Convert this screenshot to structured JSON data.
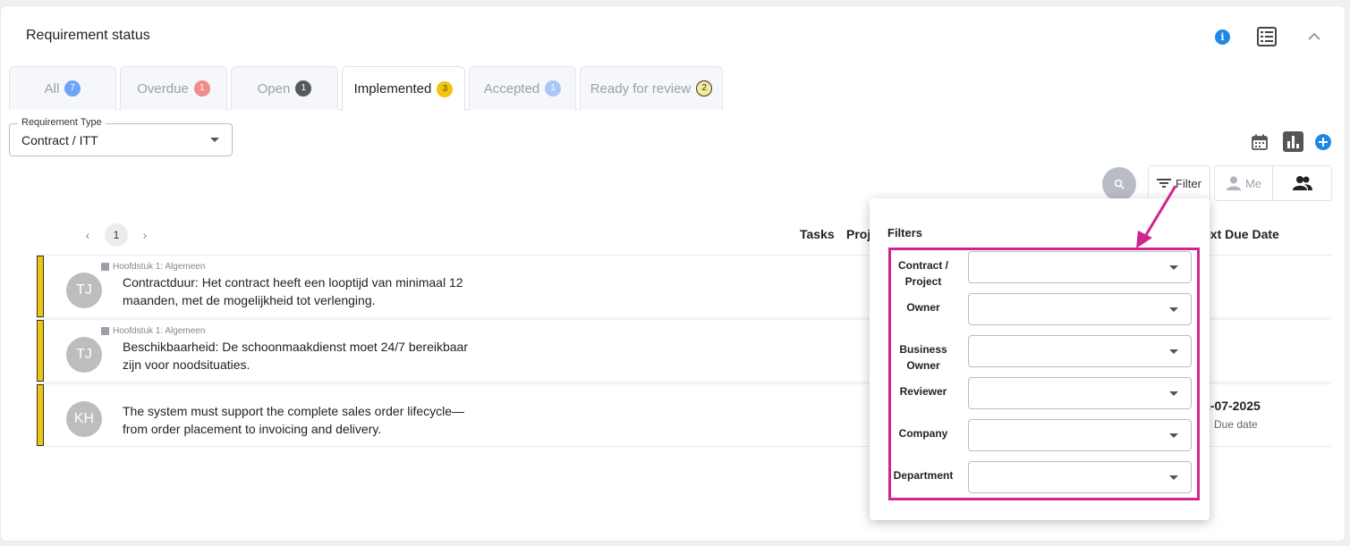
{
  "header": {
    "title": "Requirement status"
  },
  "tabs": [
    {
      "label": "All",
      "count": "7",
      "badge_color": "#6fa3f7"
    },
    {
      "label": "Overdue",
      "count": "1",
      "badge_color": "#f28b8b"
    },
    {
      "label": "Open",
      "count": "1",
      "badge_color": "#555a60"
    },
    {
      "label": "Implemented",
      "count": "3",
      "badge_color": "#f2c40f",
      "active": true
    },
    {
      "label": "Accepted",
      "count": "1",
      "badge_color": "#a9c8f7"
    },
    {
      "label": "Ready for review",
      "count": "2",
      "badge_color": "#f7e99a"
    }
  ],
  "requirement_type": {
    "label": "Requirement Type",
    "value": "Contract / ITT"
  },
  "toolbar": {
    "filter_label": "Filter",
    "me_label": "Me"
  },
  "pager": {
    "current": "1"
  },
  "columns": {
    "tasks": "Tasks",
    "project": "Proj",
    "next_due": "ext Due Date"
  },
  "rows": [
    {
      "initials": "TJ",
      "chapter": "Hoofdstuk 1: Algemeen",
      "text": "Contractduur: Het contract heeft een looptijd van minimaal 12 maanden, met de mogelijkheid tot verlenging.",
      "due": "",
      "due_label": ""
    },
    {
      "initials": "TJ",
      "chapter": "Hoofdstuk 1: Algemeen",
      "text": "Beschikbaarheid: De schoonmaakdienst moet 24/7 bereikbaar zijn voor noodsituaties.",
      "due": "",
      "due_label": ""
    },
    {
      "initials": "KH",
      "chapter": "",
      "text": "The system must support the complete sales order lifecycle—from order placement to invoicing and delivery.",
      "due": "1-07-2025",
      "due_label": "Due date"
    }
  ],
  "filters": {
    "title": "Filters",
    "fields": [
      {
        "label": "Contract / Project"
      },
      {
        "label": "Owner"
      },
      {
        "label": "Business Owner"
      },
      {
        "label": "Reviewer"
      },
      {
        "label": "Company"
      },
      {
        "label": "Department"
      }
    ]
  },
  "colors": {
    "highlight": "#d0258f",
    "row_bar": "#f1c40f",
    "accent": "#1e88e5"
  }
}
